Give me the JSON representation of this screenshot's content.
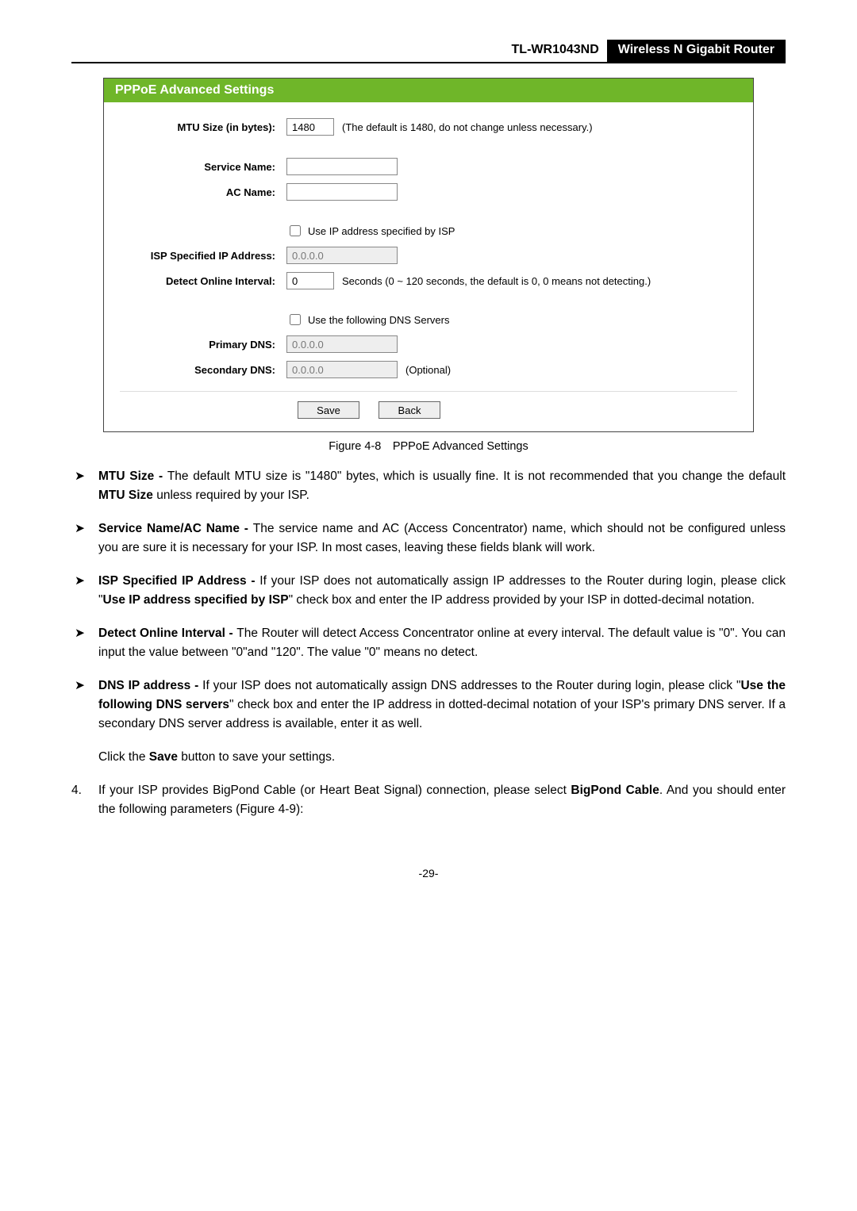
{
  "header": {
    "model": "TL-WR1043ND",
    "badge": "Wireless N Gigabit Router"
  },
  "panel": {
    "title": "PPPoE Advanced Settings",
    "mtu_label": "MTU Size (in bytes):",
    "mtu_value": "1480",
    "mtu_note": "(The default is 1480, do not change unless necessary.)",
    "service_label": "Service Name:",
    "acname_label": "AC Name:",
    "use_ip_label": "Use IP address specified by ISP",
    "isp_ip_label": "ISP Specified IP Address:",
    "isp_ip_value": "0.0.0.0",
    "detect_label": "Detect Online Interval:",
    "detect_value": "0",
    "detect_note": "Seconds (0 ~ 120 seconds, the default is 0, 0 means not detecting.)",
    "use_dns_label": "Use the following DNS Servers",
    "primary_dns_label": "Primary DNS:",
    "primary_dns_value": "0.0.0.0",
    "secondary_dns_label": "Secondary DNS:",
    "secondary_dns_value": "0.0.0.0",
    "optional": "(Optional)",
    "save": "Save",
    "back": "Back"
  },
  "caption": "Figure 4-8 PPPoE Advanced Settings",
  "body": {
    "mark": "➤",
    "li1_a": "MTU Size - ",
    "li1_b": "The default MTU size is \"1480\" bytes, which is usually fine. It is not recommended that you change the default ",
    "li1_c": "MTU Size",
    "li1_d": " unless required by your ISP.",
    "li2_a": "Service Name/AC Name - ",
    "li2_b": "The service name and AC (Access Concentrator) name, which should not be configured unless you are sure it is necessary for your ISP. In most cases, leaving these fields blank will work.",
    "li3_a": "ISP Specified IP Address - ",
    "li3_b": "If your ISP does not automatically assign IP addresses to the Router during login, please click \"",
    "li3_c": "Use IP address specified by ISP",
    "li3_d": "\" check box and enter the IP address provided by your ISP in dotted-decimal notation.",
    "li4_a": "Detect Online Interval - ",
    "li4_b": "The Router will detect Access Concentrator online at every interval. The default value is \"0\". You can input the value between \"0\"and \"120\". The value \"0\" means no detect.",
    "li5_a": "DNS IP address - ",
    "li5_b": "If your ISP does not automatically assign DNS addresses to the Router during login, please click \"",
    "li5_c": "Use the following DNS servers",
    "li5_d": "\" check box and enter the IP address in dotted-decimal notation of your ISP's primary DNS server. If a secondary DNS server address is available, enter it as well.",
    "p_save_a": "Click the ",
    "p_save_b": "Save",
    "p_save_c": " button to save your settings.",
    "n4_a": "If your ISP provides BigPond Cable (or Heart Beat Signal) connection, please select ",
    "n4_b": "BigPond Cable",
    "n4_c": ". And you should enter the following parameters (Figure 4-9):"
  },
  "footer": "-29-"
}
